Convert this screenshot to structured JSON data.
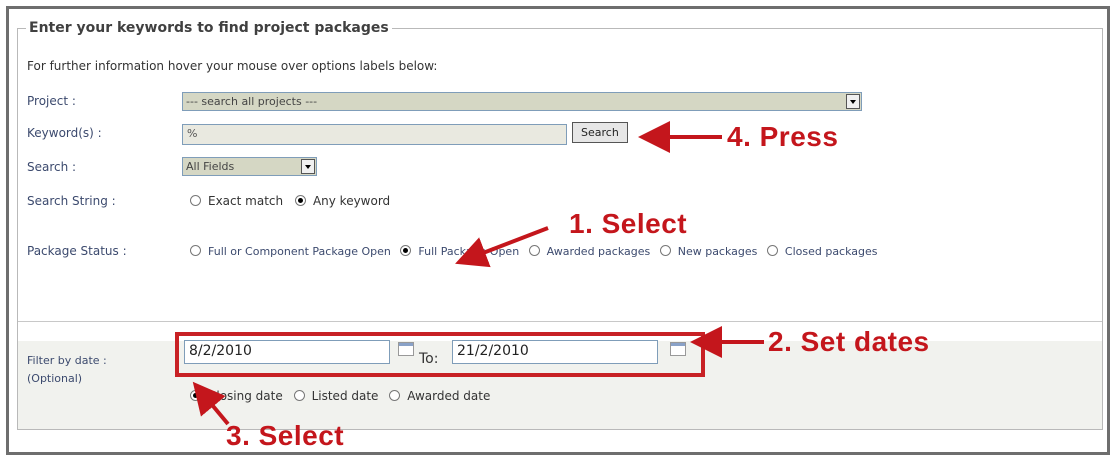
{
  "legend": "Enter your keywords to find project packages",
  "info": "For further information hover your mouse over options labels below:",
  "labels": {
    "project": "Project :",
    "keywords": "Keyword(s) :",
    "search": "Search :",
    "search_string": "Search String :",
    "package_status": "Package Status :",
    "filter_by_date": "Filter by date :",
    "optional": "(Optional)",
    "to": "To:"
  },
  "project_select": {
    "value": "--- search all projects ---"
  },
  "keyword_input": {
    "value": "%"
  },
  "search_button": "Search",
  "search_select": {
    "value": "All Fields"
  },
  "search_string_options": [
    "Exact match",
    "Any keyword"
  ],
  "package_status_options": [
    "Full or Component Package Open",
    "Full Package Open",
    "Awarded packages",
    "New packages",
    "Closed packages"
  ],
  "dates": {
    "from": "8/2/2010",
    "to": "21/2/2010"
  },
  "date_type_options": [
    "Closing date",
    "Listed date",
    "Awarded date"
  ],
  "annotations": {
    "press": "4. Press",
    "select1": "1. Select",
    "set_dates": "2. Set dates",
    "select3": "3. Select"
  },
  "colors": {
    "annotation_red": "#c82125",
    "label_blue": "#3c4a6e"
  }
}
